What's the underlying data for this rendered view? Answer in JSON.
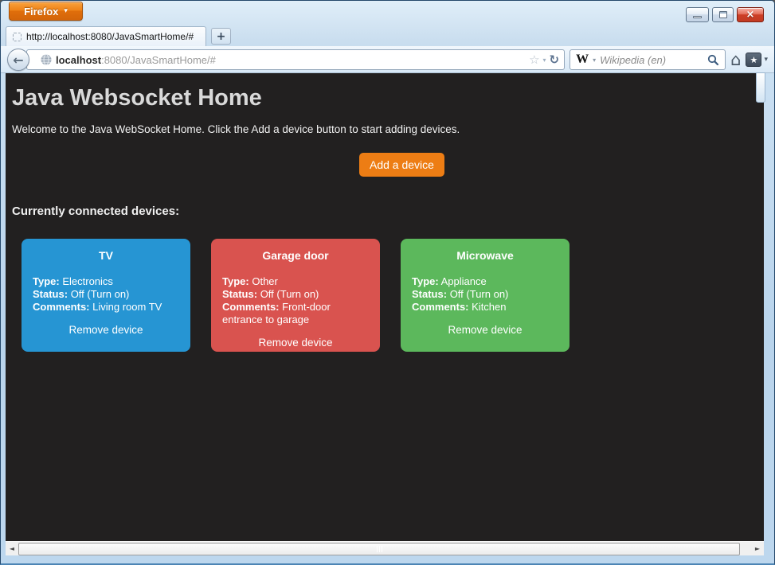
{
  "chrome": {
    "app_button_label": "Firefox",
    "window_controls": {
      "close_glyph": "×"
    }
  },
  "tab": {
    "title": "http://localhost:8080/JavaSmartHome/#"
  },
  "navbar": {
    "url_host": "localhost",
    "url_rest": ":8080/JavaSmartHome/#",
    "search_engine_logo": "W",
    "search_placeholder": "Wikipedia (en)"
  },
  "icons": {
    "caret_down": "▾",
    "back_arrow": "←",
    "star_outline": "☆",
    "reload": "↻",
    "plus": "+",
    "home": "⌂",
    "bookmark_star": "★",
    "scroll_left": "◄",
    "scroll_right": "►"
  },
  "page": {
    "title": "Java Websocket Home",
    "welcome": "Welcome to the Java WebSocket Home. Click the Add a device button to start adding devices.",
    "add_button_label": "Add a device",
    "devices_heading": "Currently connected devices:",
    "labels": {
      "type": "Type:",
      "status": "Status:",
      "comments": "Comments:",
      "remove": "Remove device"
    },
    "devices": [
      {
        "name": "TV",
        "type": "Electronics",
        "status": "Off (Turn on)",
        "comments": "Living room TV",
        "color": "#2695d3"
      },
      {
        "name": "Garage door",
        "type": "Other",
        "status": "Off (Turn on)",
        "comments": "Front-door entrance to garage",
        "color": "#d9534f"
      },
      {
        "name": "Microwave",
        "type": "Appliance",
        "status": "Off (Turn on)",
        "comments": "Kitchen",
        "color": "#5cb85c"
      }
    ],
    "theme": {
      "background": "#222020",
      "accent_orange": "#ed7d14",
      "card_blue": "#2695d3",
      "card_red": "#d9534f",
      "card_green": "#5cb85c"
    }
  }
}
